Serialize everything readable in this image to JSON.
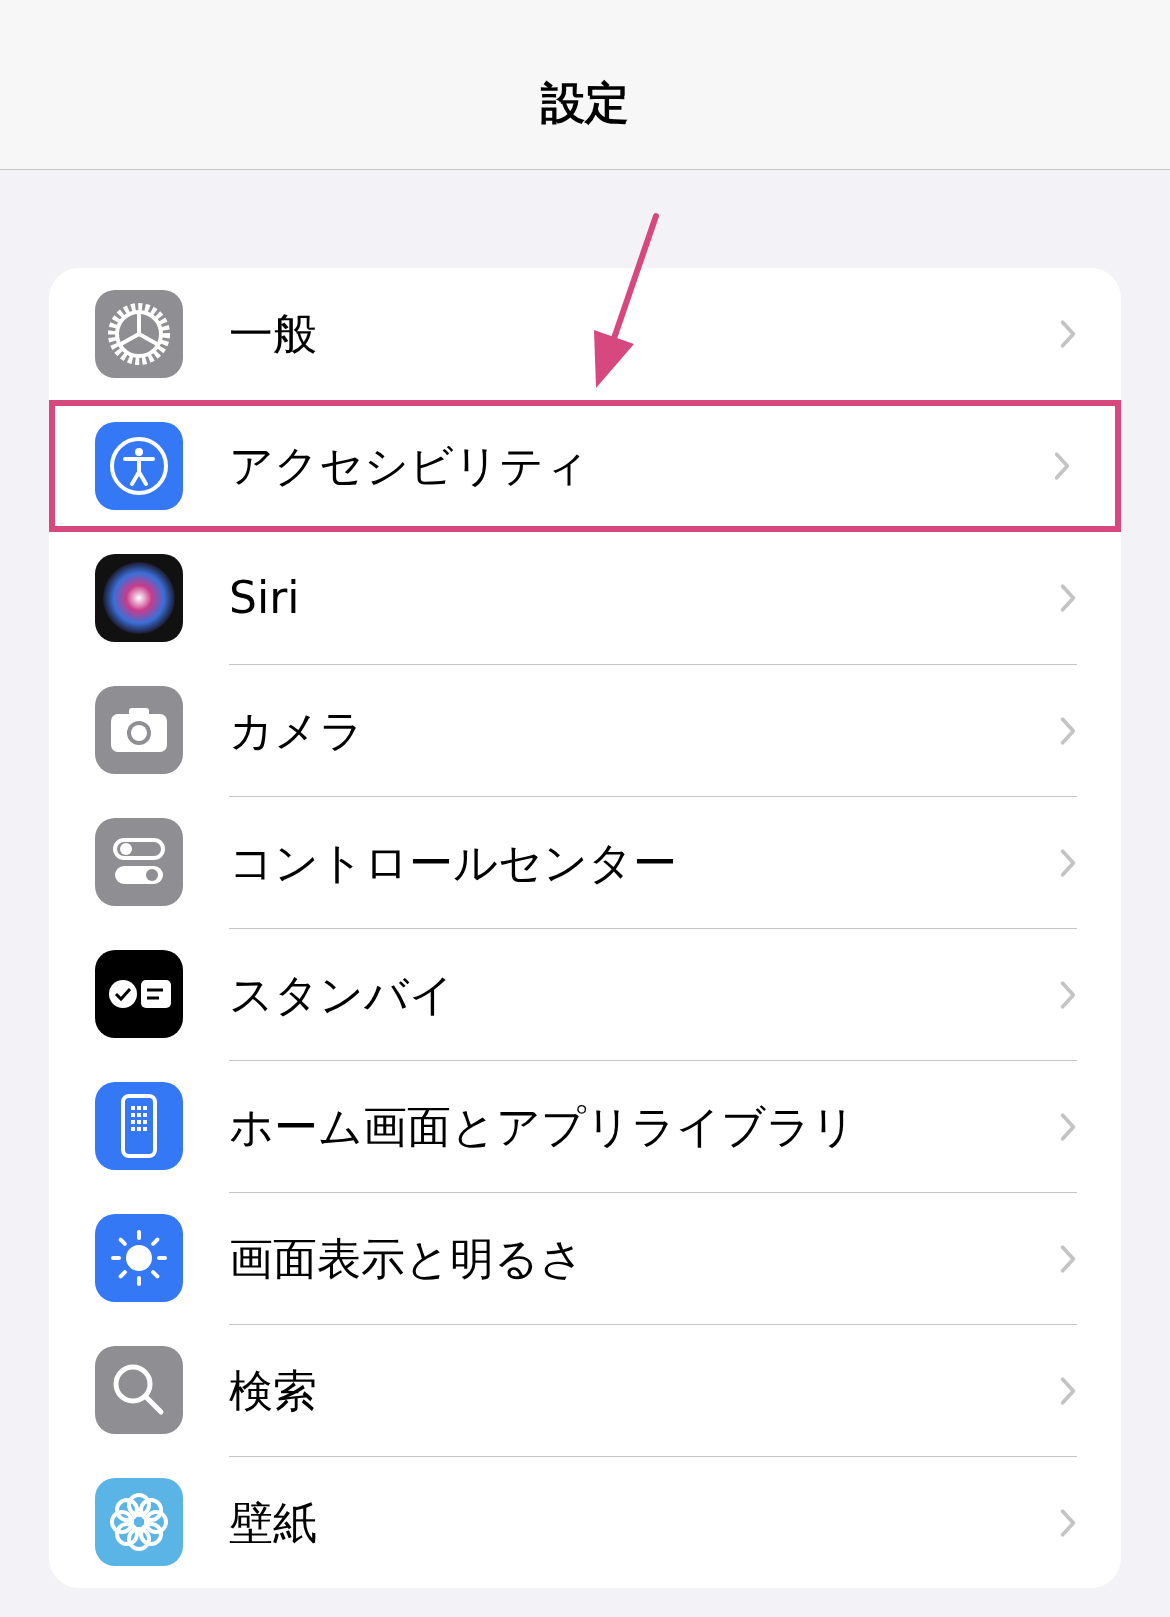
{
  "header": {
    "title": "設定"
  },
  "items": [
    {
      "label": "一般",
      "kind": "gear",
      "highlighted": false
    },
    {
      "label": "アクセシビリティ",
      "kind": "accessibility",
      "highlighted": true
    },
    {
      "label": "Siri",
      "kind": "siri",
      "highlighted": false
    },
    {
      "label": "カメラ",
      "kind": "camera",
      "highlighted": false
    },
    {
      "label": "コントロールセンター",
      "kind": "control",
      "highlighted": false
    },
    {
      "label": "スタンバイ",
      "kind": "standby",
      "highlighted": false
    },
    {
      "label": "ホーム画面とアプリライブラリ",
      "kind": "home",
      "highlighted": false
    },
    {
      "label": "画面表示と明るさ",
      "kind": "display",
      "highlighted": false
    },
    {
      "label": "検索",
      "kind": "search",
      "highlighted": false
    },
    {
      "label": "壁紙",
      "kind": "wallpaper",
      "highlighted": false
    }
  ]
}
